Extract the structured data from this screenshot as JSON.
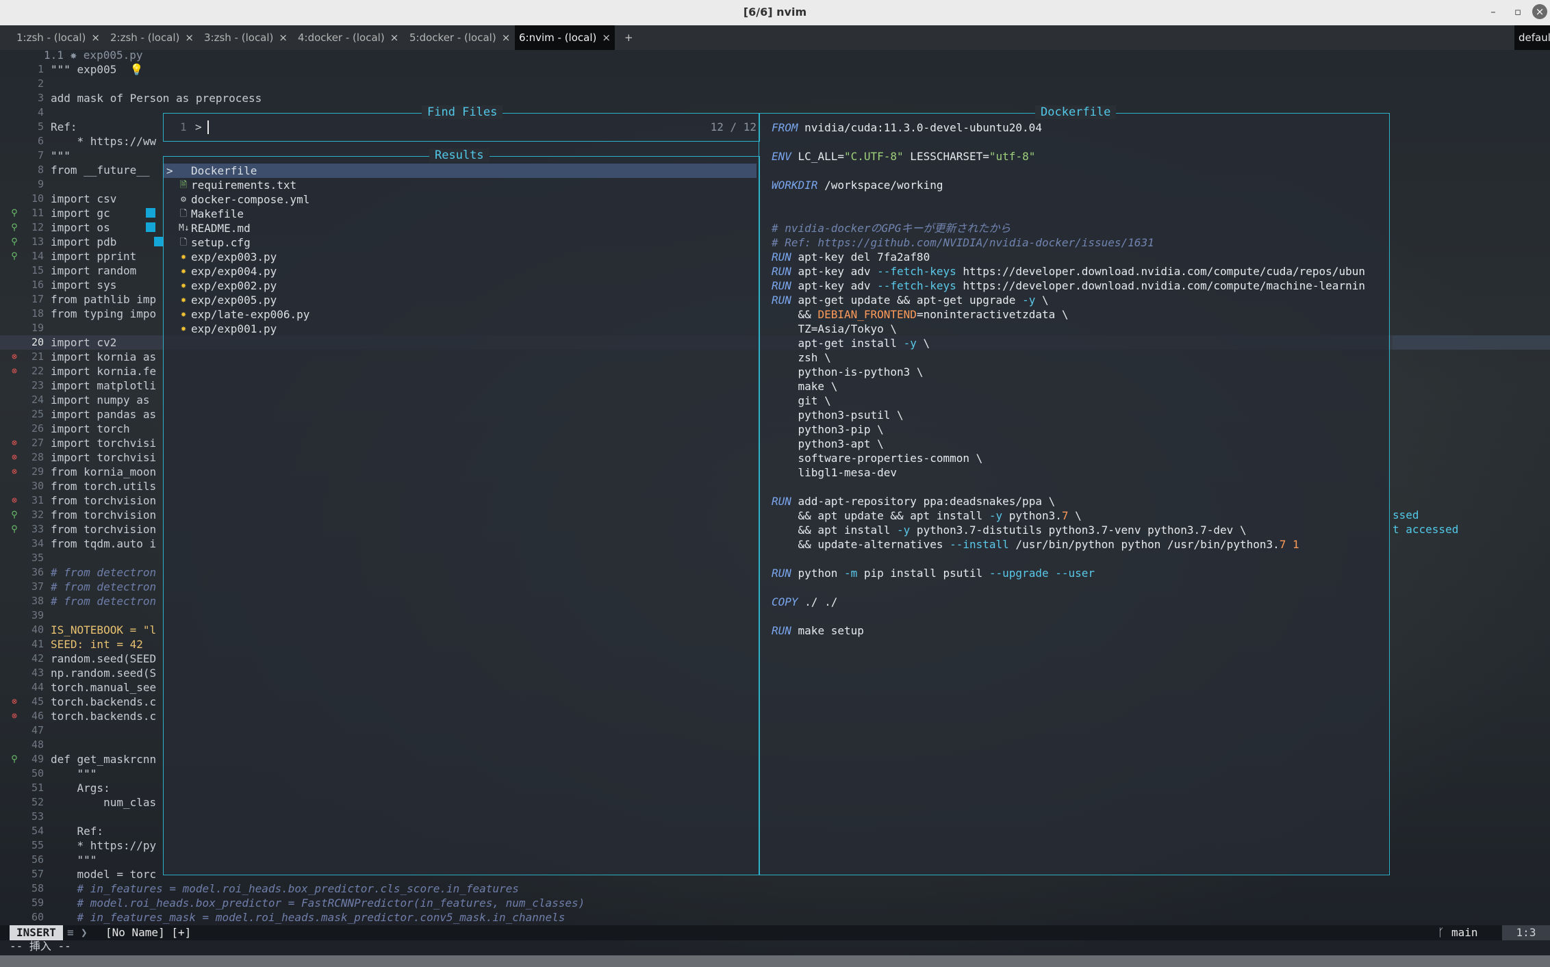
{
  "window": {
    "title": "[6/6] nvim",
    "controls": [
      "minimize-icon",
      "maximize-icon",
      "close-icon"
    ]
  },
  "tabs": [
    {
      "label": "1:zsh - (local)"
    },
    {
      "label": "2:zsh - (local)"
    },
    {
      "label": "3:zsh - (local)"
    },
    {
      "label": "4:docker - (local)"
    },
    {
      "label": "5:docker - (local)"
    },
    {
      "label": "6:nvim - (local)",
      "active": true
    }
  ],
  "tab_close_glyph": "×",
  "tab_add_glyph": "+",
  "tab_right_label": "defaul",
  "editor": {
    "winbar": "1.1 ✸ exp005.py",
    "lines": [
      {
        "n": "1",
        "t": "\"\"\" exp005  💡"
      },
      {
        "n": "2",
        "t": ""
      },
      {
        "n": "3",
        "t": "add mask of Person as preprocess"
      },
      {
        "n": "4",
        "t": ""
      },
      {
        "n": "5",
        "t": "Ref:"
      },
      {
        "n": "6",
        "t": "    * https://ww"
      },
      {
        "n": "7",
        "t": "\"\"\""
      },
      {
        "n": "8",
        "t": "from __future__"
      },
      {
        "n": "9",
        "t": ""
      },
      {
        "n": "10",
        "t": "import csv"
      },
      {
        "n": "11",
        "t": "import gc"
      },
      {
        "n": "12",
        "t": "import os"
      },
      {
        "n": "13",
        "t": "import pdb"
      },
      {
        "n": "14",
        "t": "import pprint"
      },
      {
        "n": "15",
        "t": "import random"
      },
      {
        "n": "16",
        "t": "import sys"
      },
      {
        "n": "17",
        "t": "from pathlib imp"
      },
      {
        "n": "18",
        "t": "from typing impo"
      },
      {
        "n": "19",
        "t": ""
      },
      {
        "n": "20",
        "t": "import cv2"
      },
      {
        "n": "21",
        "t": "import kornia as"
      },
      {
        "n": "22",
        "t": "import kornia.fe"
      },
      {
        "n": "23",
        "t": "import matplotli"
      },
      {
        "n": "24",
        "t": "import numpy as"
      },
      {
        "n": "25",
        "t": "import pandas as"
      },
      {
        "n": "26",
        "t": "import torch"
      },
      {
        "n": "27",
        "t": "import torchvisi"
      },
      {
        "n": "28",
        "t": "import torchvisi"
      },
      {
        "n": "29",
        "t": "from kornia_moon"
      },
      {
        "n": "30",
        "t": "from torch.utils"
      },
      {
        "n": "31",
        "t": "from torchvision"
      },
      {
        "n": "32",
        "t": "from torchvision"
      },
      {
        "n": "33",
        "t": "from torchvision"
      },
      {
        "n": "34",
        "t": "from tqdm.auto i"
      },
      {
        "n": "35",
        "t": ""
      },
      {
        "n": "36",
        "t": "# from detectron"
      },
      {
        "n": "37",
        "t": "# from detectron"
      },
      {
        "n": "38",
        "t": "# from detectron"
      },
      {
        "n": "39",
        "t": ""
      },
      {
        "n": "40",
        "t": "IS_NOTEBOOK = \"l"
      },
      {
        "n": "41",
        "t": "SEED: int = 42"
      },
      {
        "n": "42",
        "t": "random.seed(SEED"
      },
      {
        "n": "43",
        "t": "np.random.seed(S"
      },
      {
        "n": "44",
        "t": "torch.manual_see"
      },
      {
        "n": "45",
        "t": "torch.backends.c"
      },
      {
        "n": "46",
        "t": "torch.backends.c"
      },
      {
        "n": "47",
        "t": ""
      },
      {
        "n": "48",
        "t": ""
      },
      {
        "n": "49",
        "t": "def get_maskrcnn"
      },
      {
        "n": "50",
        "t": "    \"\"\""
      },
      {
        "n": "51",
        "t": "    Args:"
      },
      {
        "n": "52",
        "t": "        num_clas"
      },
      {
        "n": "53",
        "t": ""
      },
      {
        "n": "54",
        "t": "    Ref:"
      },
      {
        "n": "55",
        "t": "    * https://py"
      },
      {
        "n": "56",
        "t": "    \"\"\""
      },
      {
        "n": "57",
        "t": "    model = torc"
      },
      {
        "n": "58",
        "t": "    # in_features = model.roi_heads.box_predictor.cls_score.in_features"
      },
      {
        "n": "59",
        "t": "    # model.roi_heads.box_predictor = FastRCNNPredictor(in_features, num_classes)"
      },
      {
        "n": "60",
        "t": "    # in_features_mask = model.roi_heads.mask_predictor.conv5_mask.in_channels"
      }
    ],
    "right_fragments": [
      "ssed",
      "t accessed"
    ]
  },
  "finder": {
    "title": "Find Files",
    "prompt_num": "1",
    "prompt": ">",
    "count": "12 / 12",
    "results_title": "Results",
    "results": [
      {
        "icon": "docker-icon",
        "glyph": ">",
        "label": "Dockerfile",
        "selected": true
      },
      {
        "icon": "text-file-icon",
        "glyph": "🗎",
        "label": "requirements.txt"
      },
      {
        "icon": "gear-icon",
        "glyph": "⚙",
        "label": "docker-compose.yml"
      },
      {
        "icon": "makefile-icon",
        "glyph": "🗋",
        "label": "Makefile"
      },
      {
        "icon": "markdown-icon",
        "glyph": "M↓",
        "label": "README.md"
      },
      {
        "icon": "config-file-icon",
        "glyph": "🗋",
        "label": "setup.cfg"
      },
      {
        "icon": "python-icon",
        "glyph": "✸",
        "label": "exp/exp003.py"
      },
      {
        "icon": "python-icon",
        "glyph": "✸",
        "label": "exp/exp004.py"
      },
      {
        "icon": "python-icon",
        "glyph": "✸",
        "label": "exp/exp002.py"
      },
      {
        "icon": "python-icon",
        "glyph": "✸",
        "label": "exp/exp005.py"
      },
      {
        "icon": "python-icon",
        "glyph": "✸",
        "label": "exp/late-exp006.py"
      },
      {
        "icon": "python-icon",
        "glyph": "✸",
        "label": "exp/exp001.py"
      }
    ]
  },
  "preview": {
    "title": "Dockerfile",
    "lines": [
      [
        {
          "c": "kw",
          "t": "FROM"
        },
        {
          "t": " nvidia/cuda:11.3.0-devel-ubuntu20.04"
        }
      ],
      [],
      [
        {
          "c": "kw",
          "t": "ENV"
        },
        {
          "t": " LC_ALL="
        },
        {
          "c": "str",
          "t": "\"C.UTF-8\""
        },
        {
          "t": " LESSCHARSET="
        },
        {
          "c": "str",
          "t": "\"utf-8\""
        }
      ],
      [],
      [
        {
          "c": "kw",
          "t": "WORKDIR"
        },
        {
          "t": " /workspace/working"
        }
      ],
      [],
      [],
      [
        {
          "c": "cmt",
          "t": "# nvidia-dockerのGPGキーが更新されたから"
        }
      ],
      [
        {
          "c": "cmt",
          "t": "# Ref: https://github.com/NVIDIA/nvidia-docker/issues/1631"
        }
      ],
      [
        {
          "c": "kw",
          "t": "RUN"
        },
        {
          "t": " apt-key del 7fa2af80"
        }
      ],
      [
        {
          "c": "kw",
          "t": "RUN"
        },
        {
          "t": " apt-key adv "
        },
        {
          "c": "flag",
          "t": "--fetch-keys"
        },
        {
          "t": " https://developer.download.nvidia.com/compute/cuda/repos/ubun"
        }
      ],
      [
        {
          "c": "kw",
          "t": "RUN"
        },
        {
          "t": " apt-key adv "
        },
        {
          "c": "flag",
          "t": "--fetch-keys"
        },
        {
          "t": " https://developer.download.nvidia.com/compute/machine-learnin"
        }
      ],
      [
        {
          "c": "kw",
          "t": "RUN"
        },
        {
          "t": " apt-get update && apt-get upgrade "
        },
        {
          "c": "flag",
          "t": "-y"
        },
        {
          "t": " \\"
        }
      ],
      [
        {
          "t": "    && "
        },
        {
          "c": "var",
          "t": "DEBIAN_FRONTEND"
        },
        {
          "t": "=noninteractivetzdata \\"
        }
      ],
      [
        {
          "t": "    TZ=Asia/Tokyo \\"
        }
      ],
      [
        {
          "t": "    apt-get install "
        },
        {
          "c": "flag",
          "t": "-y"
        },
        {
          "t": " \\"
        }
      ],
      [
        {
          "t": "    zsh \\"
        }
      ],
      [
        {
          "t": "    python-is-python3 \\"
        }
      ],
      [
        {
          "t": "    make \\"
        }
      ],
      [
        {
          "t": "    git \\"
        }
      ],
      [
        {
          "t": "    python3-psutil \\"
        }
      ],
      [
        {
          "t": "    python3-pip \\"
        }
      ],
      [
        {
          "t": "    python3-apt \\"
        }
      ],
      [
        {
          "t": "    software-properties-common \\"
        }
      ],
      [
        {
          "t": "    libgl1-mesa-dev"
        }
      ],
      [],
      [
        {
          "c": "kw",
          "t": "RUN"
        },
        {
          "t": " add-apt-repository ppa:deadsnakes/ppa \\"
        }
      ],
      [
        {
          "t": "    && apt update && apt install "
        },
        {
          "c": "flag",
          "t": "-y"
        },
        {
          "t": " python3."
        },
        {
          "c": "num",
          "t": "7"
        },
        {
          "t": " \\"
        }
      ],
      [
        {
          "t": "    && apt install "
        },
        {
          "c": "flag",
          "t": "-y"
        },
        {
          "t": " python3.7-distutils python3.7-venv python3.7-dev \\"
        }
      ],
      [
        {
          "t": "    && update-alternatives "
        },
        {
          "c": "flag",
          "t": "--install"
        },
        {
          "t": " /usr/bin/python python /usr/bin/python3."
        },
        {
          "c": "num",
          "t": "7 1"
        }
      ],
      [],
      [
        {
          "c": "kw",
          "t": "RUN"
        },
        {
          "t": " python "
        },
        {
          "c": "flag",
          "t": "-m"
        },
        {
          "t": " pip install psutil "
        },
        {
          "c": "flag",
          "t": "--upgrade --user"
        }
      ],
      [],
      [
        {
          "c": "kw",
          "t": "COPY"
        },
        {
          "t": " ./ ./"
        }
      ],
      [],
      [
        {
          "c": "kw",
          "t": "RUN"
        },
        {
          "t": " make setup"
        }
      ]
    ]
  },
  "statusline": {
    "mode": "INSERT",
    "file": "[No Name] [+]",
    "branch": "main",
    "position": "1:3"
  },
  "cmdline": "-- 挿入 --"
}
